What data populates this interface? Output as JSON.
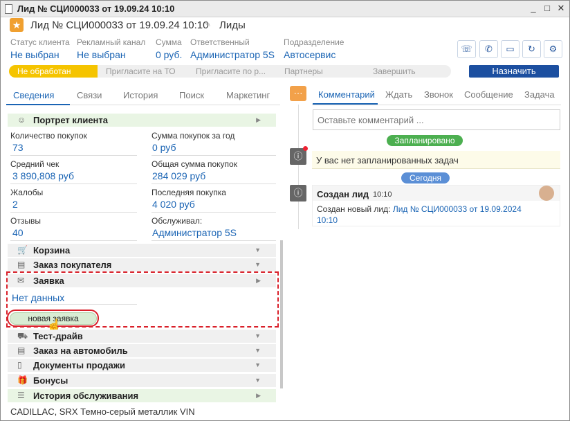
{
  "window": {
    "title": "Лид № СЦИ000033 от 19.09.24 10:10",
    "minimize": "_",
    "maximize": "□",
    "close": "✕"
  },
  "header": {
    "lead_title": "Лид № СЦИ000033 от 19.09.24 10:10",
    "lead_type": "Лиды"
  },
  "fields": {
    "client_status_label": "Статус клиента",
    "client_status_value": "Не выбран",
    "ad_channel_label": "Рекламный канал",
    "ad_channel_value": "Не выбран",
    "sum_label": "Сумма",
    "sum_value": "0 руб.",
    "responsible_label": "Ответственный",
    "responsible_value": "Администратор 5S",
    "division_label": "Подразделение",
    "division_value": "Автосервис"
  },
  "stages": [
    "Не обработан",
    "Пригласите на ТО",
    "Пригласите по р...",
    "Партнеры",
    "Завершить"
  ],
  "assign_button": "Назначить",
  "left_tabs": [
    "Сведения",
    "Связи",
    "История",
    "Поиск",
    "Маркетинг"
  ],
  "portrait": {
    "title": "Портрет клиента",
    "props": [
      {
        "label": "Количество покупок",
        "value": "73"
      },
      {
        "label": "Сумма покупок за год",
        "value": "0 руб"
      },
      {
        "label": "Средний чек",
        "value": "3 890,808 руб"
      },
      {
        "label": "Общая сумма покупок",
        "value": "284 029 руб"
      },
      {
        "label": "Жалобы",
        "value": "2"
      },
      {
        "label": "Последняя покупка",
        "value": "4 020 руб"
      },
      {
        "label": "Отзывы",
        "value": "40"
      },
      {
        "label": "Обслуживал:",
        "value": "Администратор 5S"
      }
    ]
  },
  "sections": {
    "cart": "Корзина",
    "order": "Заказ покупателя",
    "request": "Заявка",
    "request_empty": "Нет данных",
    "new_request": "новая заявка",
    "test_drive": "Тест-драйв",
    "car_order": "Заказ на автомобиль",
    "sale_docs": "Документы продажи",
    "bonuses": "Бонусы",
    "service_history": "История обслуживания"
  },
  "bottom_line": "CADILLAC, SRX Темно-серый металлик VIN",
  "right_tabs": [
    "Комментарий",
    "Ждать",
    "Звонок",
    "Сообщение",
    "Задача"
  ],
  "comment_placeholder": "Оставьте комментарий ...",
  "timeline": {
    "planned_pill": "Запланировано",
    "no_tasks": "У вас нет запланированных задач",
    "today_pill": "Сегодня",
    "event_title": "Создан лид",
    "event_time": "10:10",
    "event_text": "Создан новый лид:",
    "event_link_1": "Лид № СЦИ000033 от 19.09.2024",
    "event_link_2": "10:10"
  },
  "colors": {
    "accent": "#1a64b4",
    "stage_active": "#f5c400",
    "assign": "#1c4fa0",
    "planned": "#4caf50",
    "today": "#5b8fd6",
    "highlight": "#d9202a"
  }
}
